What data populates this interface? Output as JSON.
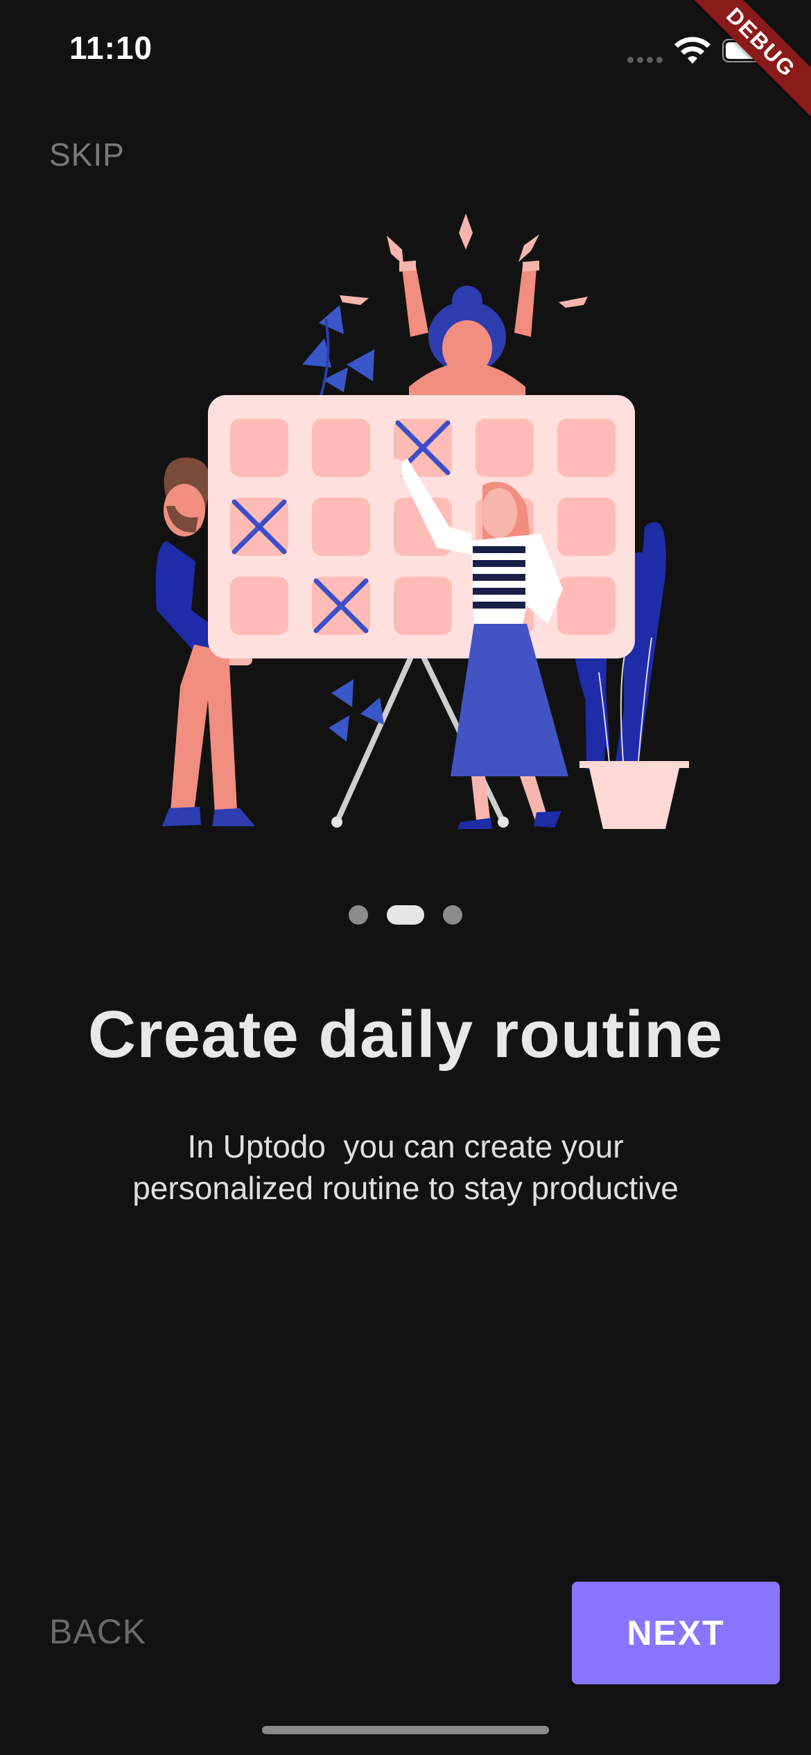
{
  "status_bar": {
    "time": "11:10",
    "icons": [
      "signal-icon",
      "wifi-icon",
      "battery-icon"
    ]
  },
  "debug_banner": "DEBUG",
  "onboarding": {
    "skip_label": "SKIP",
    "illustration": "calendar-routine-illustration",
    "page_indicator": {
      "total": 3,
      "current": 2
    },
    "title": "Create daily routine",
    "description_lines": [
      "In Uptodo  you can create your",
      "personalized routine to stay productive"
    ],
    "back_label": "BACK",
    "next_label": "NEXT"
  },
  "colors": {
    "background": "#121212",
    "accent": "#8875FF",
    "debug_banner": "#8B1A1A",
    "illustration_pink": "#FFB3B0",
    "illustration_blue": "#2E3DB0"
  }
}
